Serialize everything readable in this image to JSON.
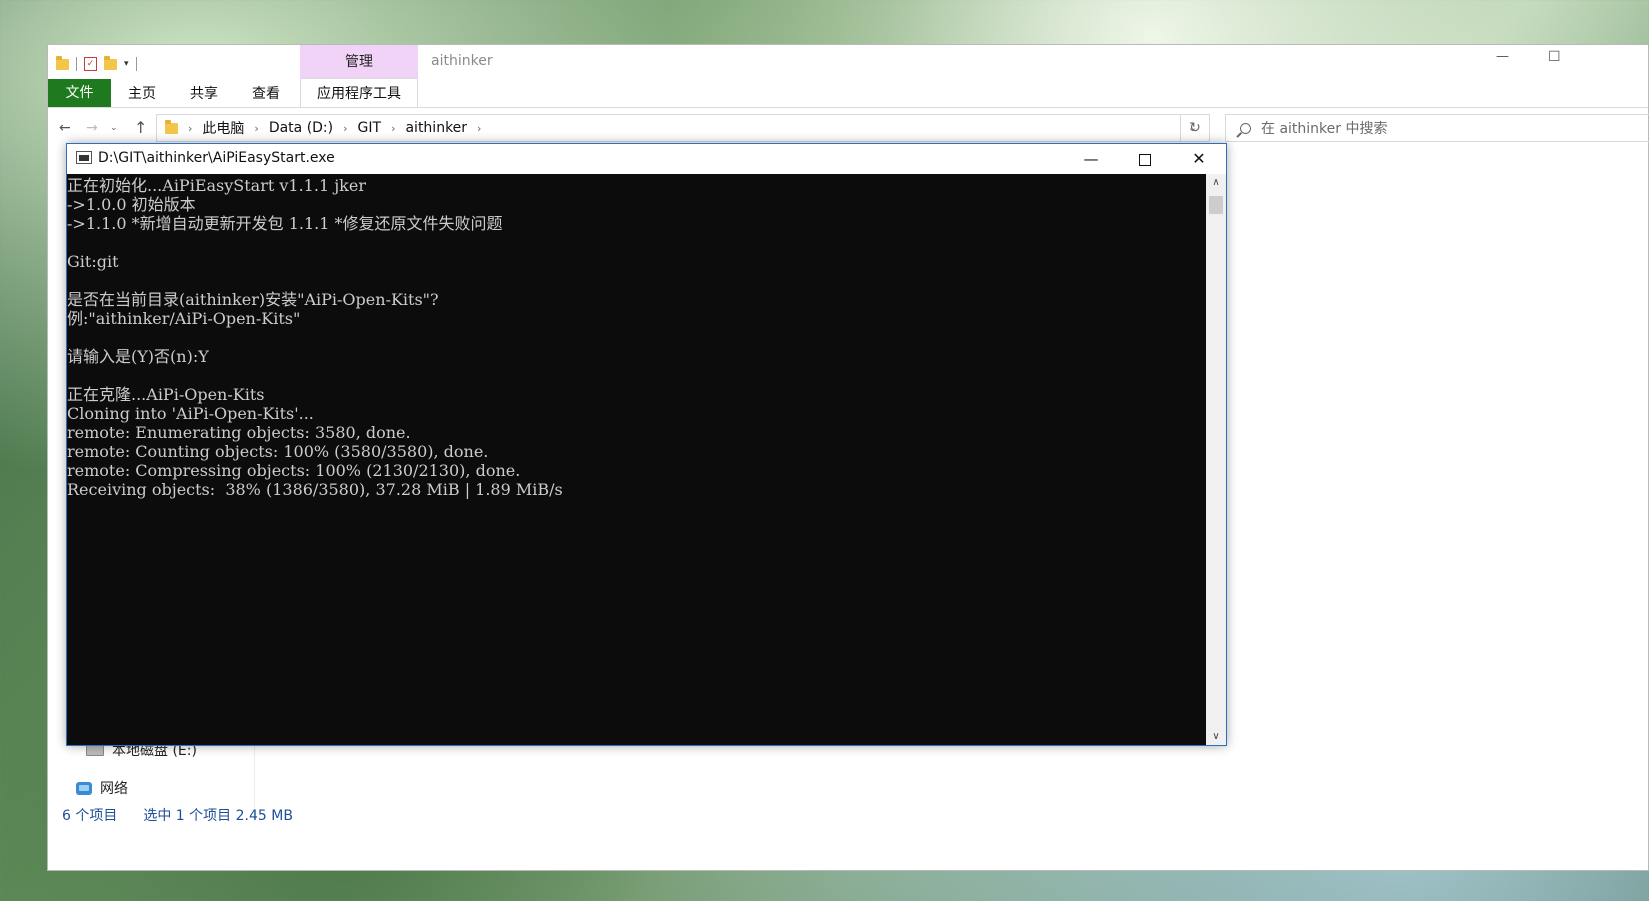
{
  "explorer": {
    "window_title": "aithinker",
    "manage_tab": "管理",
    "app_tools_label": "应用程序工具",
    "ribbon_tabs": {
      "file": "文件",
      "home": "主页",
      "share": "共享",
      "view": "查看"
    },
    "controls": {
      "minimize": "—",
      "maximize": "☐"
    },
    "nav": {
      "back": "←",
      "forward": "→",
      "history": "⌄",
      "up": "↑",
      "refresh": "↻",
      "dropdown": "⌄"
    },
    "breadcrumb": [
      "此电脑",
      "Data (D:)",
      "GIT",
      "aithinker"
    ],
    "search_placeholder": "在 aithinker 中搜索",
    "nav_pane": {
      "drive_e": "本地磁盘 (E:)",
      "network": "网络"
    },
    "status": {
      "item_count": "6 个项目",
      "selection": "选中 1 个项目  2.45 MB"
    }
  },
  "console": {
    "title": "D:\\GIT\\aithinker\\AiPiEasyStart.exe",
    "controls": {
      "minimize": "—",
      "maximize": "",
      "close": "✕"
    },
    "output": "正在初始化...AiPiEasyStart v1.1.1 jker\n->1.0.0 初始版本\n->1.1.0 *新增自动更新开发包 1.1.1 *修复还原文件失败问题\n\nGit:git\n\n是否在当前目录(aithinker)安装\"AiPi-Open-Kits\"?\n例:\"aithinker/AiPi-Open-Kits\"\n\n请输入是(Y)否(n):Y\n\n正在克隆...AiPi-Open-Kits\nCloning into 'AiPi-Open-Kits'...\nremote: Enumerating objects: 3580, done.\nremote: Counting objects: 100% (3580/3580), done.\nremote: Compressing objects: 100% (2130/2130), done.\nReceiving objects:  38% (1386/3580), 37.28 MiB | 1.89 MiB/s",
    "scroll": {
      "up": "∧",
      "down": "∨"
    }
  }
}
